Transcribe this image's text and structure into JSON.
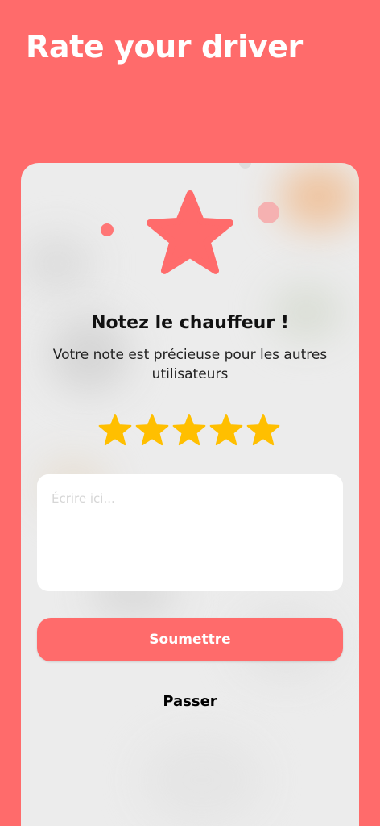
{
  "header": {
    "title": "Rate your driver"
  },
  "rating_card": {
    "hero_icon": "star-icon",
    "heading": "Notez le chauffeur !",
    "subtitle": "Votre note est précieuse pour les autres utilisateurs",
    "rating": {
      "value": 5,
      "max": 5,
      "icon": "star-icon"
    },
    "comment": {
      "value": "",
      "placeholder": "Écrire ici..."
    },
    "submit_label": "Soumettre",
    "skip_label": "Passer"
  },
  "colors": {
    "background": "#ff6b6b",
    "card": "#ececec",
    "star_gold": "#ffbf00",
    "white": "#ffffff"
  }
}
